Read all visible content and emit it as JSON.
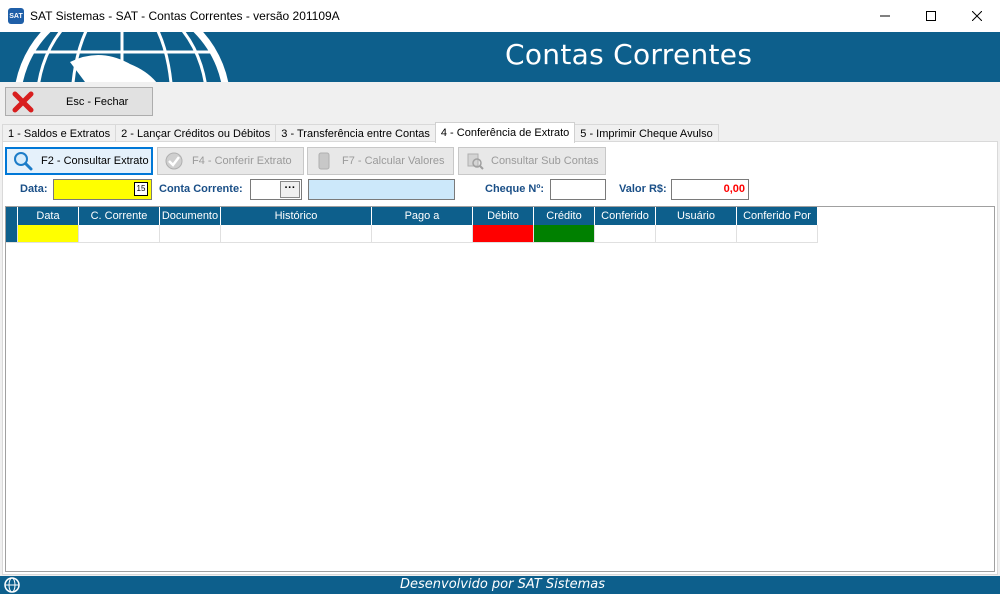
{
  "window": {
    "title": "SAT Sistemas - SAT - Contas Correntes - versão 201109A",
    "app_icon": "sat-app-icon",
    "app_icon_text": "SAT"
  },
  "banner": {
    "title": "Contas Correntes",
    "background": "#0d5f8c"
  },
  "toolbar": {
    "close_label": "Esc - Fechar"
  },
  "tabs": [
    {
      "label": "1 - Saldos e Extratos"
    },
    {
      "label": "2 - Lançar Créditos ou Débitos"
    },
    {
      "label": "3 - Transferência entre Contas"
    },
    {
      "label": "4 - Conferência de Extrato",
      "active": true
    },
    {
      "label": "5 - Imprimir Cheque Avulso"
    }
  ],
  "actions": {
    "consultar": "F2 - Consultar Extrato",
    "conferir": "F4 - Conferir Extrato",
    "calcular": "F7 - Calcular Valores",
    "subcontas": "Consultar Sub Contas"
  },
  "filters": {
    "data_label": "Data:",
    "data_value": "",
    "calendar_text": "15",
    "conta_label": "Conta Corrente:",
    "conta_value": "",
    "browse_text": "···",
    "conta_desc": "",
    "cheque_label": "Cheque Nº:",
    "cheque_value": "",
    "valor_label": "Valor R$:",
    "valor_value": "0,00"
  },
  "grid": {
    "columns": [
      "Data",
      "C. Corrente",
      "Documento",
      "Histórico",
      "Pago a",
      "Débito",
      "Crédito",
      "Conferido",
      "Usuário",
      "Conferido Por"
    ],
    "rows": [
      [
        "",
        "",
        "",
        "",
        "",
        "",
        "",
        "",
        "",
        ""
      ]
    ]
  },
  "colors": {
    "accent": "#0d5f8c",
    "date_highlight": "#ffff00",
    "debit": "#ff0000",
    "credit": "#008000",
    "value_text": "#ff0000"
  },
  "status": {
    "text": "Desenvolvido por SAT Sistemas"
  }
}
